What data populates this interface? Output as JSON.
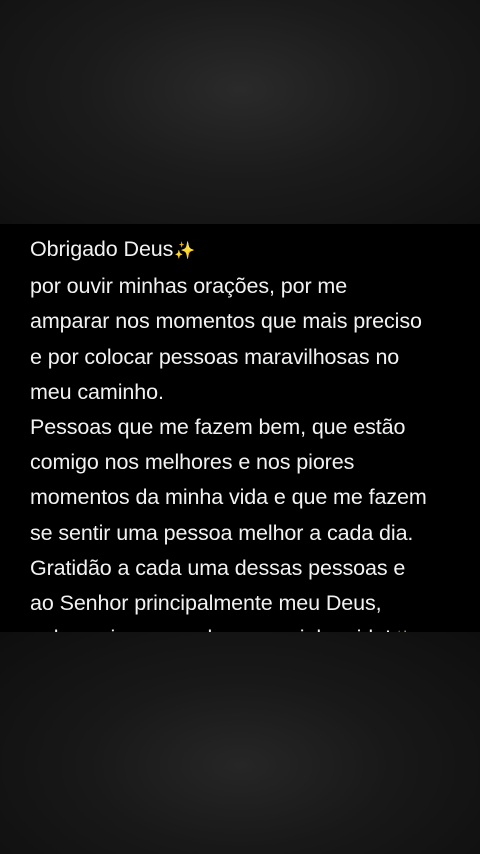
{
  "note": {
    "lines": [
      {
        "text": "Obrigado Deus",
        "sparkle": "✨"
      },
      {
        "text": "por ouvir minhas orações, por me"
      },
      {
        "text": "amparar nos momentos que mais preciso"
      },
      {
        "text": "e por colocar pessoas maravilhosas no"
      },
      {
        "text": "meu caminho."
      },
      {
        "text": "Pessoas que me fazem bem, que estão"
      },
      {
        "text": "comigo nos melhores e nos piores"
      },
      {
        "text": "momentos da minha vida e que me fazem"
      },
      {
        "text": "se sentir uma pessoa melhor a cada dia."
      },
      {
        "text": "Gratidão a cada uma dessas pessoas e"
      },
      {
        "text": "ao Senhor principalmente meu Deus,"
      },
      {
        "text": "pelos anjos que coloca na minha vida!",
        "sparkle": "✨"
      }
    ]
  },
  "colors": {
    "text": "#f2f2f2",
    "panel": "#000000",
    "background": "#0b0b0b"
  }
}
